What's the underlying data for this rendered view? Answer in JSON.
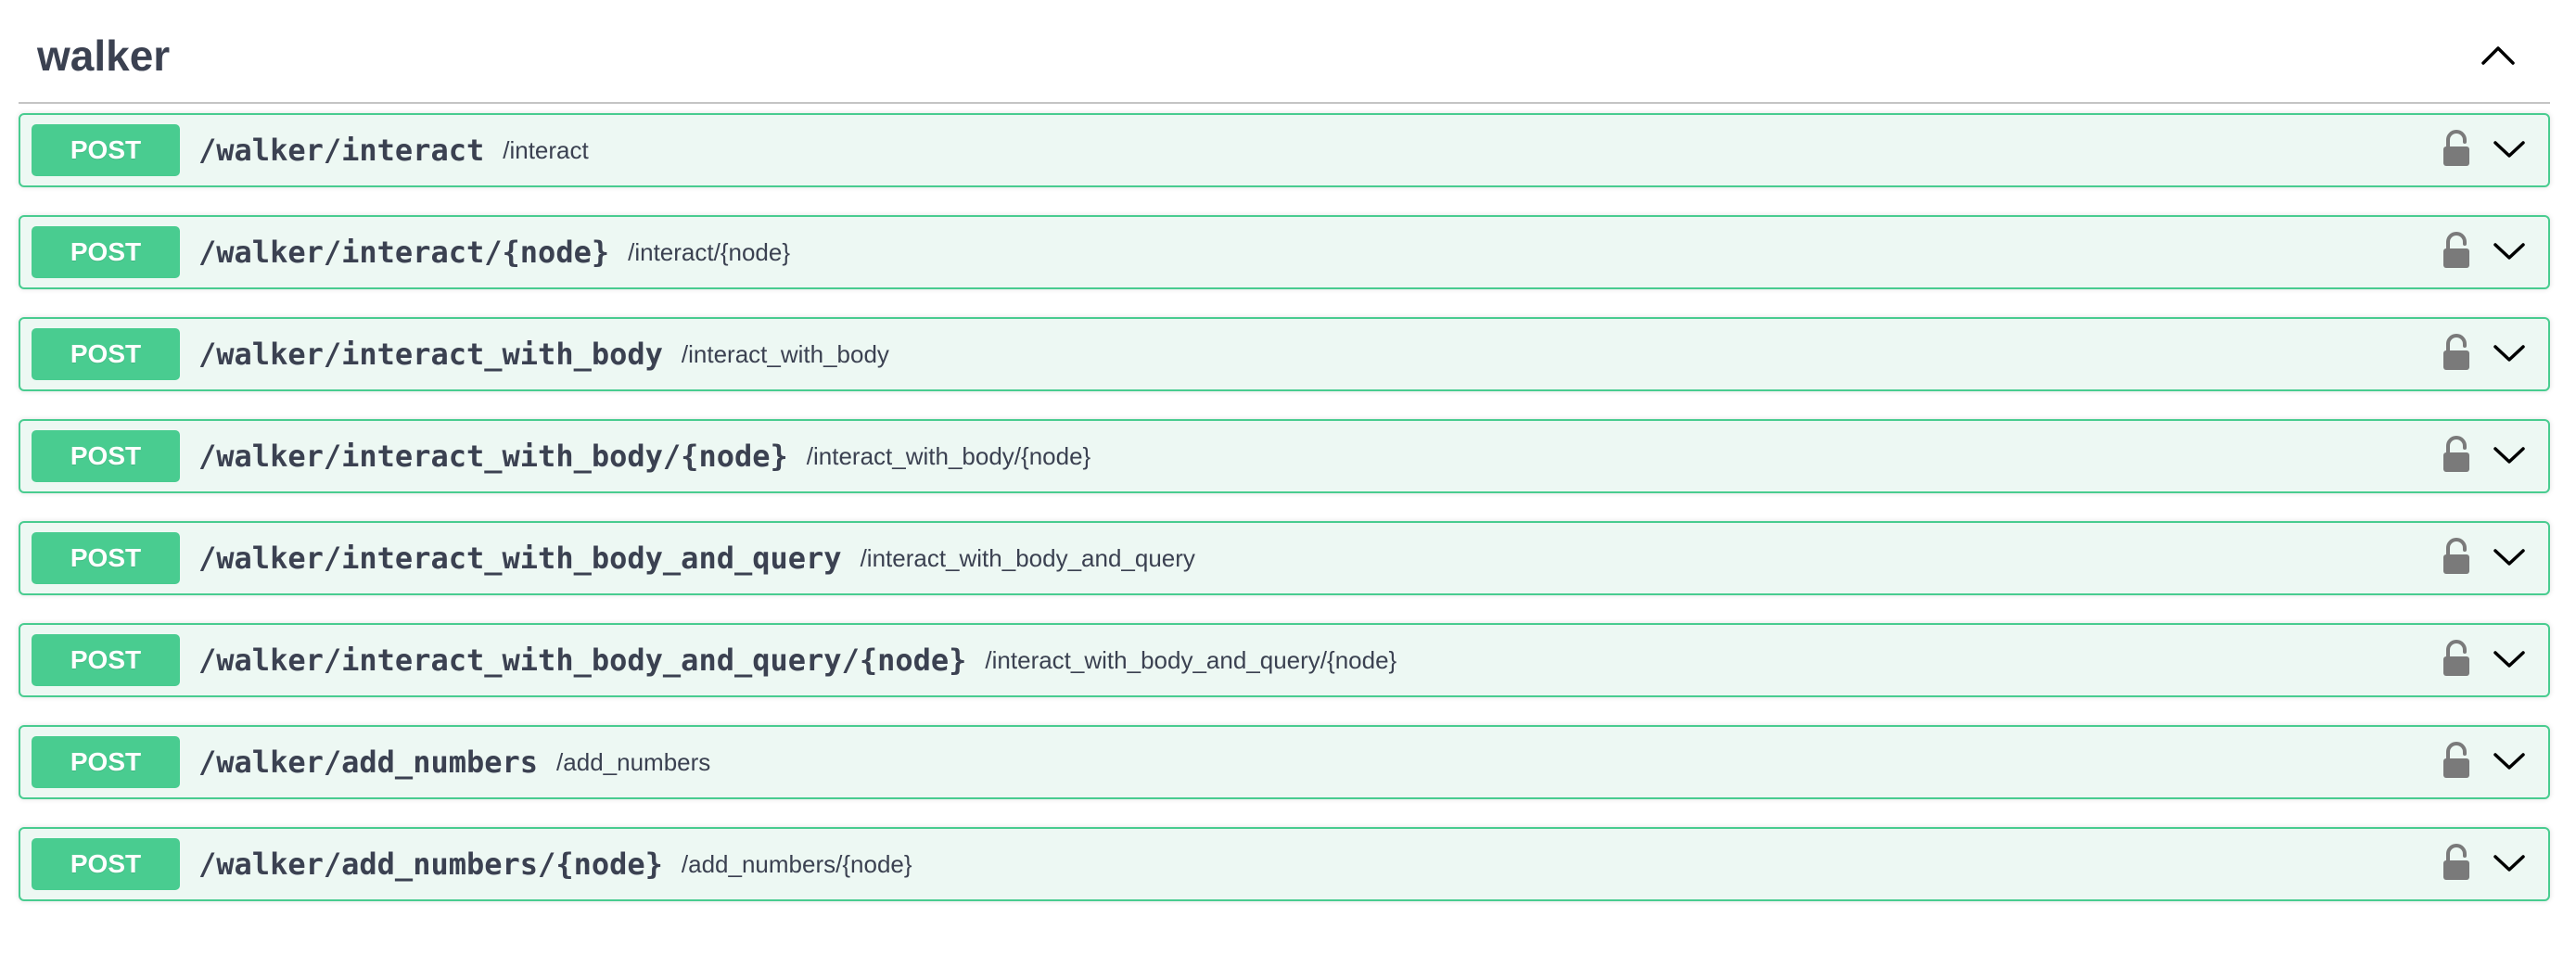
{
  "section": {
    "title": "walker",
    "toggle_icon": "chevron-up-icon"
  },
  "colors": {
    "post_accent": "#49cc90",
    "post_background": "#edf8f3",
    "text": "#3b4151",
    "lock_icon": "#7a7a7a"
  },
  "operations": [
    {
      "method": "POST",
      "path": "/walker/interact",
      "summary": "/interact"
    },
    {
      "method": "POST",
      "path": "/walker/interact/{node}",
      "summary": "/interact/{node}"
    },
    {
      "method": "POST",
      "path": "/walker/interact_with_body",
      "summary": "/interact_with_body"
    },
    {
      "method": "POST",
      "path": "/walker/interact_with_body/{node}",
      "summary": "/interact_with_body/{node}"
    },
    {
      "method": "POST",
      "path": "/walker/interact_with_body_and_query",
      "summary": "/interact_with_body_and_query"
    },
    {
      "method": "POST",
      "path": "/walker/interact_with_body_and_query/{node}",
      "summary": "/interact_with_body_and_query/{node}"
    },
    {
      "method": "POST",
      "path": "/walker/add_numbers",
      "summary": "/add_numbers"
    },
    {
      "method": "POST",
      "path": "/walker/add_numbers/{node}",
      "summary": "/add_numbers/{node}"
    }
  ]
}
